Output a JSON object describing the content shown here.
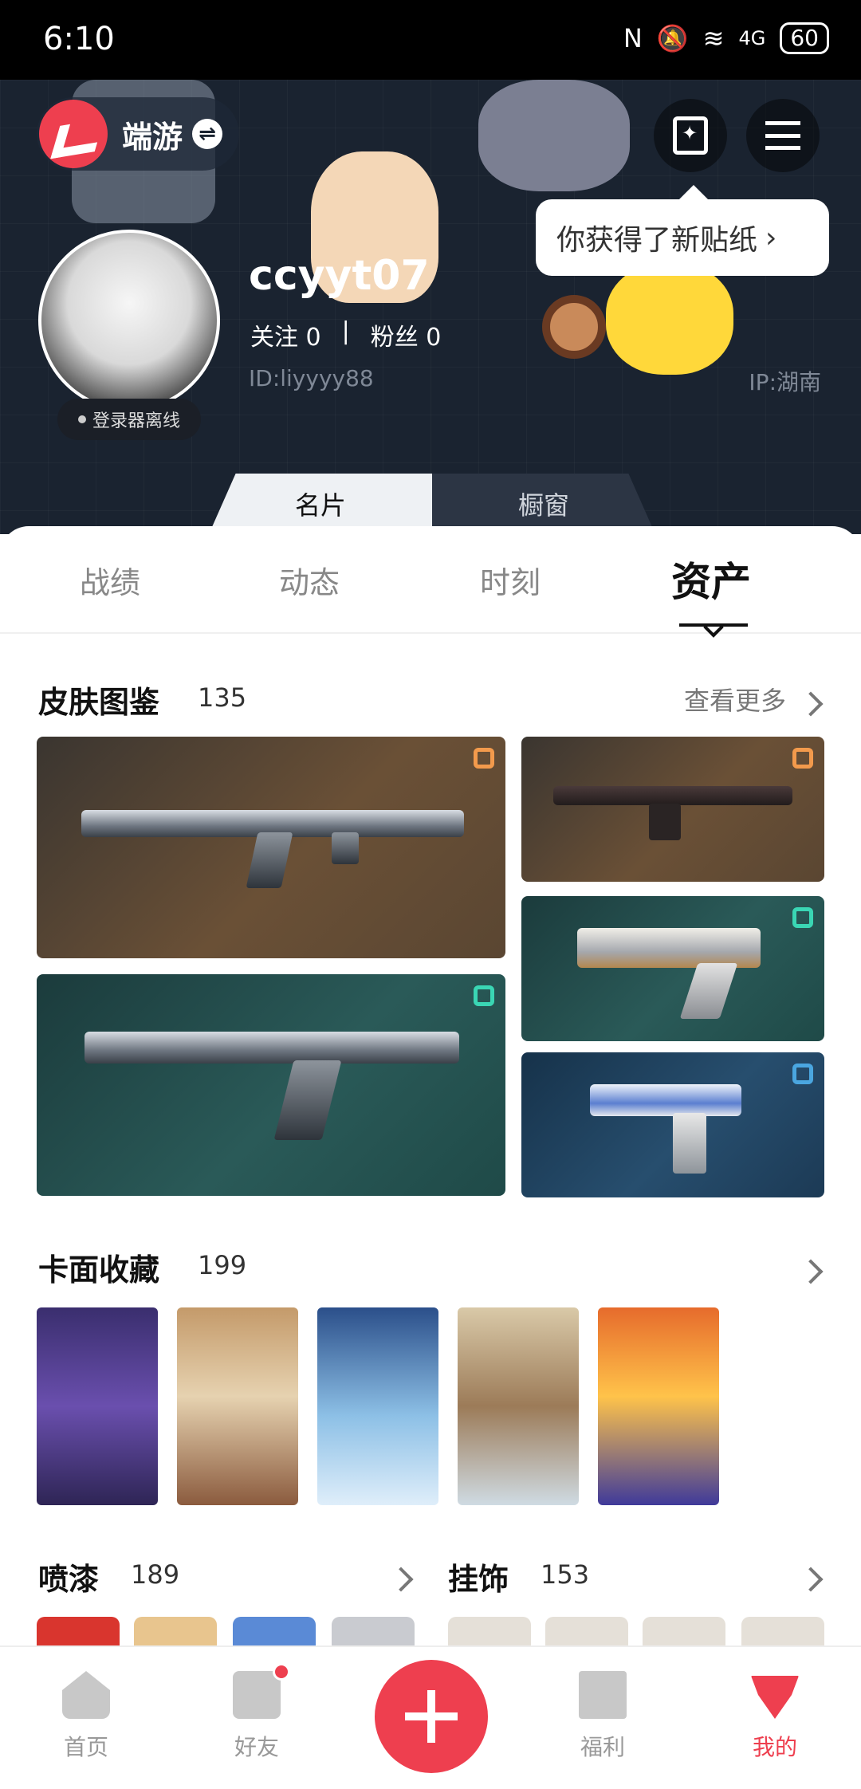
{
  "status_bar": {
    "time": "6:10",
    "battery": "60",
    "network": "4G"
  },
  "header": {
    "app_name": "端游",
    "tooltip": "你获得了新贴纸",
    "username": "ccyyt07",
    "follow_label": "关注",
    "follow_count": "0",
    "fans_label": "粉丝",
    "fans_count": "0",
    "user_id": "ID:liyyyy88",
    "ip": "IP:湖南",
    "login_status": "登录器离线",
    "card_tabs": [
      {
        "label": "名片"
      },
      {
        "label": "橱窗"
      }
    ]
  },
  "main_tabs": [
    {
      "label": "战绩"
    },
    {
      "label": "动态"
    },
    {
      "label": "时刻"
    },
    {
      "label": "资产"
    }
  ],
  "skins": {
    "title": "皮肤图鉴",
    "count": "135",
    "more": "查看更多"
  },
  "cards": {
    "title": "卡面收藏",
    "count": "199"
  },
  "sprays": {
    "title": "喷漆",
    "count": "189"
  },
  "charms": {
    "title": "挂饰",
    "count": "153"
  },
  "bottom_nav": [
    {
      "label": "首页"
    },
    {
      "label": "好友"
    },
    {
      "label": "福利"
    },
    {
      "label": "我的"
    }
  ],
  "colors": {
    "accent": "#ee3f4f",
    "header_bg": "#1a2330"
  }
}
